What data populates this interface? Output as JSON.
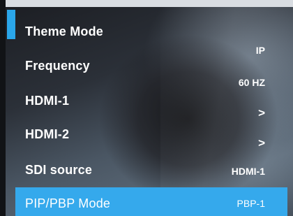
{
  "menu": {
    "items": [
      {
        "label": "Theme Mode",
        "value": "IP"
      },
      {
        "label": "Frequency",
        "value": "60 HZ"
      },
      {
        "label": "HDMI-1",
        "value": ">"
      },
      {
        "label": "HDMI-2",
        "value": ">"
      },
      {
        "label": "SDI source",
        "value": "HDMI-1"
      },
      {
        "label": "PIP/PBP Mode",
        "value": "PBP-1"
      }
    ],
    "selected_index": 5
  },
  "colors": {
    "accent": "#2aa6ea",
    "selected_row": "#35a9ec",
    "text": "#ffffff"
  },
  "icons": {
    "submenu": "chevron-right-icon"
  }
}
